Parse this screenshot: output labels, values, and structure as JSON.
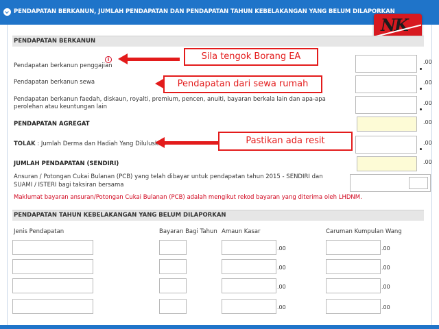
{
  "header": {
    "title": "PENDAPATAN BERKANUN, JUMLAH PENDAPATAN DAN PENDAPATAN TAHUN KEBELAKANGAN YANG BELUM DILAPORKAN"
  },
  "logo": {
    "text": "NK"
  },
  "section1": {
    "title": "PENDAPATAN BERKANUN",
    "rows": {
      "employment": "Pendapatan berkanun penggajian",
      "rental": "Pendapatan berkanun sewa",
      "other_line1": "Pendapatan berkanun faedah, diskaun, royalti, premium, pencen, anuiti, bayaran berkala lain dan apa-apa",
      "other_line2": "perolehan atau keuntungan lain",
      "aggregate": "PENDAPATAN AGREGAT",
      "deduct_bold": "TOLAK",
      "deduct_rest": ": Jumlah Derma dan Hadiah Yang Diluluskan",
      "total": "JUMLAH PENDAPATAN (SENDIRI)",
      "pcb_line1": "Ansuran / Potongan Cukai Bulanan (PCB) yang telah dibayar untuk pendapatan tahun 2015 - SENDIRI dan",
      "pcb_line2": "SUAMI / ISTERI bagi taksiran bersama",
      "pcb_notice": "Maklumat bayaran ansuran/Potongan Cukai Bulanan (PCB) adalah mengikut rekod bayaran yang diterima oleh LHDNM."
    },
    "decimal": ".00",
    "info_icon_text": "i"
  },
  "section2": {
    "title": "PENDAPATAN TAHUN KEBELAKANGAN YANG BELUM DILAPORKAN",
    "columns": {
      "income_type": "Jenis Pendapatan",
      "year": "Bayaran Bagi Tahun",
      "gross": "Amaun Kasar",
      "epf": "Caruman Kumpulan Wang"
    },
    "decimal": ".00"
  },
  "annotations": {
    "ea": "Sila tengok Borang EA",
    "rental": "Pendapatan dari sewa rumah",
    "receipt": "Pastikan ada resit"
  },
  "colors": {
    "header_blue": "#1f74c9",
    "annotation_red": "#e31b1b",
    "notice_red": "#d0021b",
    "computed_field_yellow": "#fdfbd6"
  }
}
